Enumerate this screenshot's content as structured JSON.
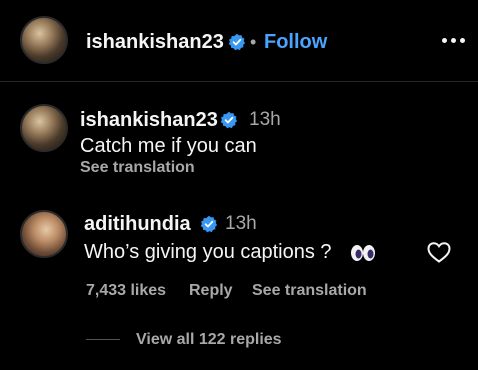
{
  "header": {
    "username": "ishankishan23",
    "separator": "•",
    "follow_label": "Follow"
  },
  "comments": [
    {
      "username": "ishankishan23",
      "time": "13h",
      "text": "Catch me if you can",
      "see_translation": "See translation"
    },
    {
      "username": "aditihundia",
      "time": "13h",
      "text": "Who’s giving you captions ?",
      "likes": "7,433 likes",
      "reply_label": "Reply",
      "see_translation": "See translation",
      "view_replies": "View all 122 replies"
    }
  ],
  "colors": {
    "background": "#000000",
    "link_blue": "#4aa3ff",
    "verified_blue": "#3897f0",
    "muted_text": "#a8a8a8"
  },
  "icons": {
    "verified": "verified-badge-icon",
    "more": "more-options-icon",
    "like": "heart-outline-icon",
    "emoji": "eyes-emoji-icon"
  }
}
